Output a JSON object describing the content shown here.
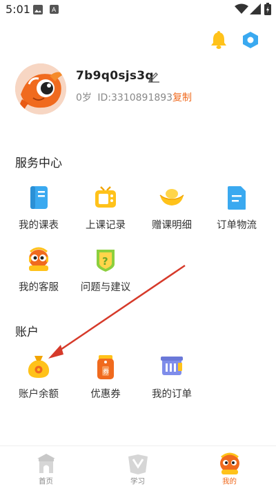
{
  "status_bar": {
    "time": "5:01"
  },
  "header": {
    "bell_icon": "bell-icon",
    "settings_icon": "hexagon-settings-icon"
  },
  "profile": {
    "username": "7b9q0sjs3q",
    "age": "0岁",
    "id_text": "ID:3310891893",
    "copy_label": "复制"
  },
  "service_center": {
    "title": "服务中心",
    "items": [
      {
        "label": "我的课表",
        "icon": "schedule-book-icon"
      },
      {
        "label": "上课记录",
        "icon": "tv-icon"
      },
      {
        "label": "赠课明细",
        "icon": "gold-ingot-icon"
      },
      {
        "label": "订单物流",
        "icon": "document-icon"
      },
      {
        "label": "我的客服",
        "icon": "fish-mascot-service-icon"
      },
      {
        "label": "问题与建议",
        "icon": "question-shield-icon"
      }
    ]
  },
  "account": {
    "title": "账户",
    "items": [
      {
        "label": "账户余额",
        "icon": "money-bag-icon"
      },
      {
        "label": "优惠券",
        "icon": "coupon-tag-icon"
      },
      {
        "label": "我的订单",
        "icon": "order-list-icon"
      }
    ]
  },
  "bottom_nav": {
    "items": [
      {
        "label": "首页",
        "icon": "home-gate-icon"
      },
      {
        "label": "学习",
        "icon": "study-icon"
      },
      {
        "label": "我的",
        "icon": "fish-profile-icon",
        "active": true
      }
    ]
  },
  "colors": {
    "accent": "#f06a1e",
    "icon_blue": "#3aa9f0",
    "icon_yellow": "#ffc21a"
  }
}
